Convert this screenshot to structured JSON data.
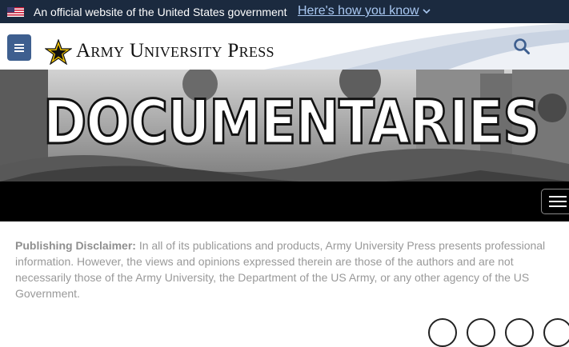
{
  "gov_banner": {
    "text": "An official website of the United States government",
    "link": "Here's how you know"
  },
  "header": {
    "brand": "Army University Press",
    "icons": [
      "menu-icon",
      "army-star-logo",
      "search-icon"
    ]
  },
  "hero": {
    "title": "DOCUMENTARIES"
  },
  "disclaimer": {
    "label": "Publishing Disclaimer:",
    "text": " In all of its publications and products, Army University Press presents professional information. However, the views and opinions expressed therein are those of the authors and are not necessarily those of the Army University, the Department of the US Army, or any other agency of the US Government."
  },
  "colors": {
    "gov_banner_bg": "#1b2a3f",
    "menu_button": "#3e5f8f",
    "link": "#a9c8f2",
    "disclaimer_text": "#999999"
  }
}
